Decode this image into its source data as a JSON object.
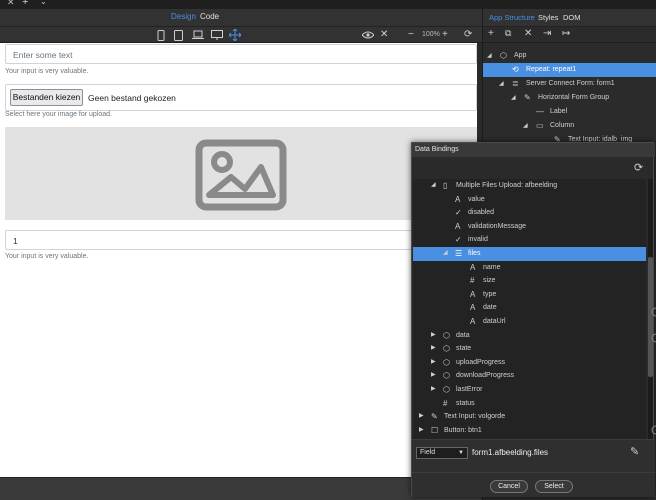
{
  "window": {
    "tab_close": "✕",
    "tab_add": "+",
    "tab_chevron": "⌄"
  },
  "design_bar": {
    "tabs": [
      {
        "label": "Design",
        "active": true
      },
      {
        "label": "Code",
        "active": false
      }
    ]
  },
  "device_bar": {
    "zoom": "100%",
    "icons": [
      "phone-icon",
      "tablet-icon",
      "laptop-icon",
      "desktop-icon",
      "move-icon",
      "eye-icon",
      "close-icon",
      "zoom-out-icon",
      "zoom-in-icon",
      "refresh-icon"
    ]
  },
  "canvas": {
    "text_input_placeholder": "Enter some text",
    "text_input_help": "Your input is very valuable.",
    "file_button": "Bestanden kiezen",
    "file_status": "Geen bestand gekozen",
    "file_help": "Select here your image for upload.",
    "order_value": "1",
    "order_help": "Your input is very valuable."
  },
  "panel": {
    "tabs": [
      {
        "label": "App Structure",
        "active": true
      },
      {
        "label": "Styles",
        "active": false
      },
      {
        "label": "DOM",
        "active": false
      }
    ],
    "tree": [
      {
        "label": "App",
        "icon": "cube-icon",
        "level": 0,
        "expanded": true,
        "selected": false
      },
      {
        "label": "Repeat: repeat1",
        "icon": "repeat-icon",
        "level": 1,
        "expanded": null,
        "selected": true
      },
      {
        "label": "Server Connect Form: form1",
        "icon": "database-icon",
        "level": 1,
        "expanded": true,
        "selected": false
      },
      {
        "label": "Horizontal Form Group",
        "icon": "pencil-icon",
        "level": 2,
        "expanded": true,
        "selected": false
      },
      {
        "label": "Label",
        "icon": "dash-icon",
        "level": 3,
        "expanded": null,
        "selected": false
      },
      {
        "label": "Column",
        "icon": "column-icon",
        "level": 3,
        "expanded": true,
        "selected": false
      },
      {
        "label": "Text Input: idalb_img",
        "icon": "pencil-icon",
        "level": 4,
        "expanded": null,
        "selected": false
      }
    ]
  },
  "dialog": {
    "title": "Data Bindings",
    "tree": [
      {
        "label": "Multiple Files Upload: afbeelding",
        "icon": "file-icon",
        "arrow": "down"
      },
      {
        "label": "value",
        "icon": "text-icon",
        "arrow": ""
      },
      {
        "label": "disabled",
        "icon": "check-icon",
        "arrow": ""
      },
      {
        "label": "validationMessage",
        "icon": "text-icon",
        "arrow": ""
      },
      {
        "label": "invalid",
        "icon": "check-icon",
        "arrow": ""
      },
      {
        "label": "files",
        "icon": "list-icon",
        "arrow": "down",
        "selected": true
      },
      {
        "label": "name",
        "icon": "text-icon",
        "arrow": ""
      },
      {
        "label": "size",
        "icon": "number-icon",
        "arrow": ""
      },
      {
        "label": "type",
        "icon": "text-icon",
        "arrow": ""
      },
      {
        "label": "date",
        "icon": "text-icon",
        "arrow": ""
      },
      {
        "label": "dataUrl",
        "icon": "text-icon",
        "arrow": ""
      },
      {
        "label": "data",
        "icon": "cube-icon",
        "arrow": "right"
      },
      {
        "label": "state",
        "icon": "cube-icon",
        "arrow": "right"
      },
      {
        "label": "uploadProgress",
        "icon": "cube-icon",
        "arrow": "right"
      },
      {
        "label": "downloadProgress",
        "icon": "cube-icon",
        "arrow": "right"
      },
      {
        "label": "lastError",
        "icon": "cube-icon",
        "arrow": "right"
      },
      {
        "label": "status",
        "icon": "number-icon",
        "arrow": ""
      },
      {
        "label": "Text Input: volgorde",
        "icon": "pencil-icon",
        "arrow": "right"
      },
      {
        "label": "Button: btn1",
        "icon": "square-icon",
        "arrow": "right"
      }
    ],
    "field_type": "Field",
    "expression": "form1.afbeelding.files",
    "cancel": "Cancel",
    "select": "Select"
  },
  "colors": {
    "accent": "#4a90e2",
    "panel_bg": "#2b2b2b",
    "canvas_bg": "#ffffff"
  }
}
